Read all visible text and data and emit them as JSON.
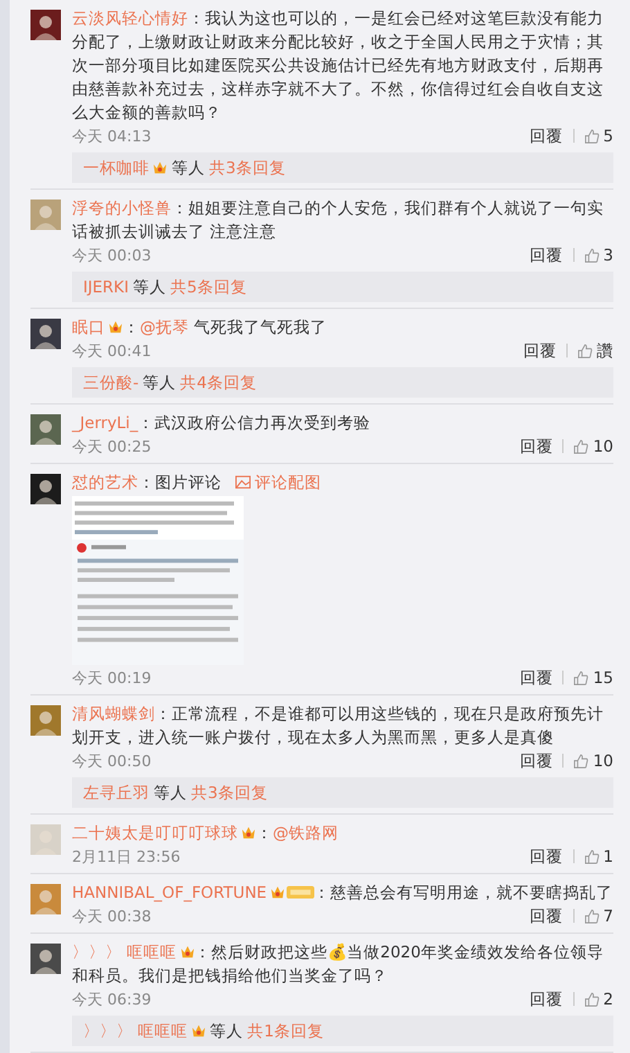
{
  "comments": [
    {
      "name": "云淡风轻心情好",
      "badge": false,
      "sep": "：",
      "text": "我认为这也可以的，一是红会已经对这笔巨款没有能力分配了，上缴财政让财政来分配比较好，收之于全国人民用之于灾情；其次一部分项目比如建医院买公共设施估计已经先有地方财政支付，后期再由慈善款补充过去，这样赤字就不大了。不然，你信得过红会自收自支这么大金额的善款吗？",
      "time": "今天 04:13",
      "reply": "回覆",
      "likes": "5",
      "thread": {
        "who": "一杯咖啡",
        "badge": true,
        "etc": "等人",
        "count": "共3条回复"
      }
    },
    {
      "name": "浮夸的小怪兽",
      "badge": false,
      "sep": "：",
      "text": "姐姐要注意自己的个人安危，我们群有个人就说了一句实话被抓去训诫去了 注意注意",
      "time": "今天 00:03",
      "reply": "回覆",
      "likes": "3",
      "thread": {
        "who": "IJERKI",
        "badge": false,
        "etc": "等人",
        "count": "共5条回复"
      }
    },
    {
      "name": "眠口",
      "badge": true,
      "sep": "：",
      "mention": "@抚琴",
      "text": " 气死我了气死我了",
      "time": "今天 00:41",
      "reply": "回覆",
      "likes": "讚",
      "thread": {
        "who": "三份酸-",
        "badge": false,
        "etc": "等人",
        "count": "共4条回复"
      }
    },
    {
      "name": "_JerryLi_",
      "badge": false,
      "sep": "：",
      "text": "武汉政府公信力再次受到考验",
      "time": "今天 00:25",
      "reply": "回覆",
      "likes": "10"
    },
    {
      "name": "怼的艺术",
      "badge": false,
      "sep": "：",
      "text": "图片评论",
      "image_link": "评论配图",
      "time": "今天 00:19",
      "reply": "回覆",
      "likes": "15"
    },
    {
      "name": "清风蝴蝶剑",
      "badge": false,
      "sep": "：",
      "text": "正常流程，不是谁都可以用这些钱的，现在只是政府预先计划开支，进入统一账户拨付，现在太多人为黑而黑，更多人是真傻",
      "time": "今天 00:50",
      "reply": "回覆",
      "likes": "10",
      "thread": {
        "who": "左寻丘羽",
        "badge": false,
        "etc": "等人",
        "count": "共3条回复"
      }
    },
    {
      "name": "二十姨太是叮叮叮球球",
      "badge": true,
      "sep": "：",
      "mention": "@铁路网",
      "time": "2月11日 23:56",
      "reply": "回覆",
      "likes": "1"
    },
    {
      "name": "HANNIBAL_OF_FORTUNE",
      "badge": true,
      "fan": true,
      "sep": "：",
      "text": "慈善总会有写明用途，就不要瞎捣乱了",
      "time": "今天 00:38",
      "reply": "回覆",
      "likes": "7"
    },
    {
      "name": "〉〉〉 哐哐哐",
      "badge": true,
      "sep": "：",
      "text": "然后财政把这些💰当做2020年奖金绩效发给各位领导和科员。我们是把钱捐给他们当奖金了吗？",
      "time": "今天 06:39",
      "reply": "回覆",
      "likes": "2",
      "thread": {
        "who": "〉〉〉 哐哐哐",
        "badge": true,
        "etc": "等人",
        "count": "共1条回复"
      }
    }
  ]
}
